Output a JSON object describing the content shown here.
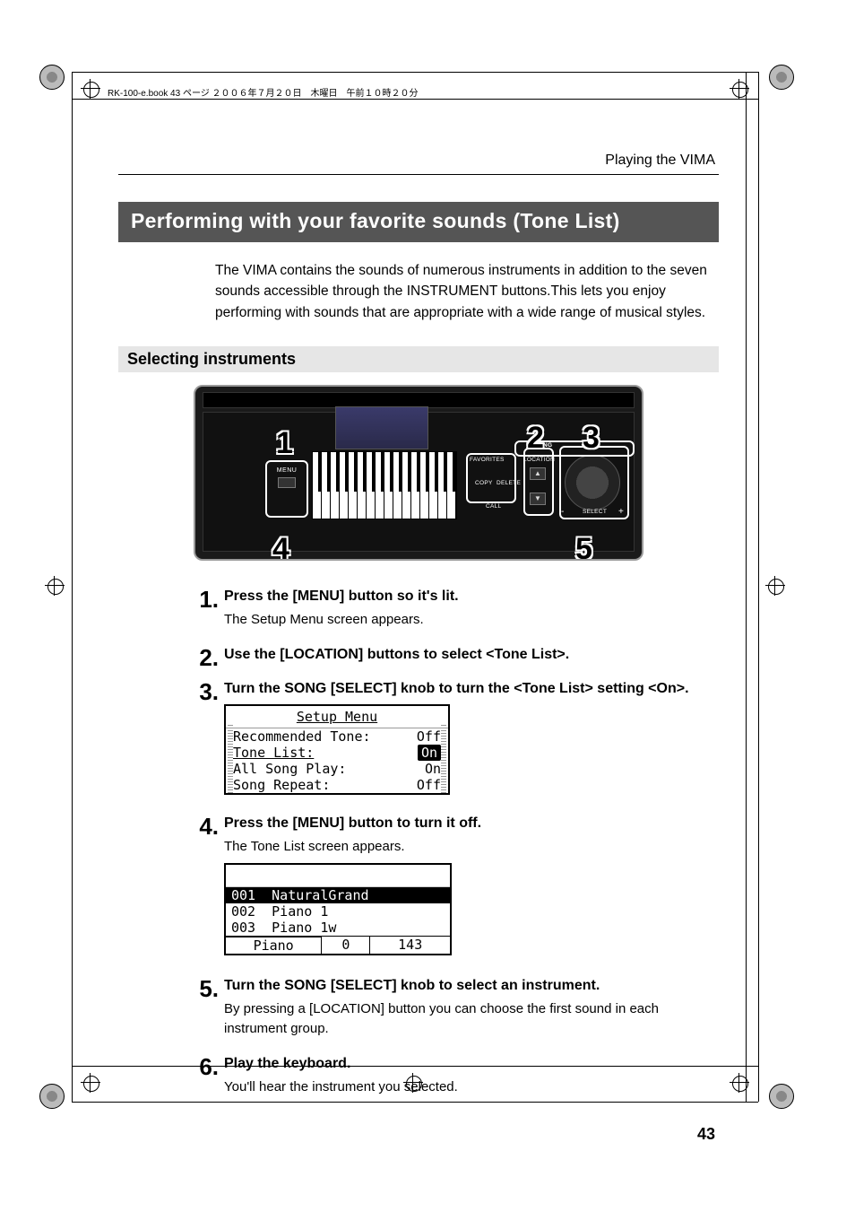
{
  "book_header": "RK-100-e.book  43 ページ  ２００６年７月２０日　木曜日　午前１０時２０分",
  "running_head": "Playing the VIMA",
  "section_title": "Performing with your favorite sounds (Tone List)",
  "intro": "The VIMA contains the sounds of numerous instruments in addition to the seven sounds accessible through the INSTRUMENT buttons.This lets you enjoy performing with sounds that are appropriate with a wide range of musical styles.",
  "subsection": "Selecting instruments",
  "panel": {
    "callouts": {
      "n1": "1",
      "n2": "2",
      "n3": "3",
      "n4": "4",
      "n5": "5"
    },
    "labels": {
      "menu": "MENU",
      "song": "SONG",
      "favorites": "FAVORITES",
      "location": "LOCATION",
      "copy": "COPY",
      "delete": "DELETE",
      "call": "CALL",
      "select": "SELECT",
      "minus": "-",
      "plus": "+"
    }
  },
  "steps": [
    {
      "num": "1.",
      "title": "Press the [MENU] button so it's lit.",
      "text": "The Setup Menu screen appears."
    },
    {
      "num": "2.",
      "title": "Use the [LOCATION] buttons to select <Tone List>."
    },
    {
      "num": "3.",
      "title": "Turn the SONG [SELECT] knob to turn the <Tone List> setting <On>."
    },
    {
      "num": "4.",
      "title": "Press the [MENU] button to turn it off.",
      "text": "The Tone List screen appears."
    },
    {
      "num": "5.",
      "title": "Turn the SONG [SELECT] knob to select an instrument.",
      "text": "By pressing a [LOCATION] button you can choose the first sound in each instrument group."
    },
    {
      "num": "6.",
      "title": "Play the keyboard.",
      "text": "You'll hear the instrument you selected."
    }
  ],
  "setup_menu": {
    "title": "Setup Menu",
    "rows": [
      {
        "label": "Recommended Tone:",
        "value": "Off",
        "hl": false
      },
      {
        "label": "Tone List:",
        "value": "On",
        "hl": true,
        "underline": true
      },
      {
        "label": "All Song Play:",
        "value": "On",
        "hl": false
      },
      {
        "label": "Song Repeat:",
        "value": "Off",
        "hl": false
      }
    ]
  },
  "tone_list": {
    "rows": [
      {
        "num": "001",
        "name": "NaturalGrand",
        "hl": true
      },
      {
        "num": "002",
        "name": "Piano 1",
        "hl": false
      },
      {
        "num": "003",
        "name": "Piano 1w",
        "hl": false
      }
    ],
    "footer": {
      "cat": "Piano",
      "a": "0",
      "b": "143"
    }
  },
  "page_number": "43"
}
